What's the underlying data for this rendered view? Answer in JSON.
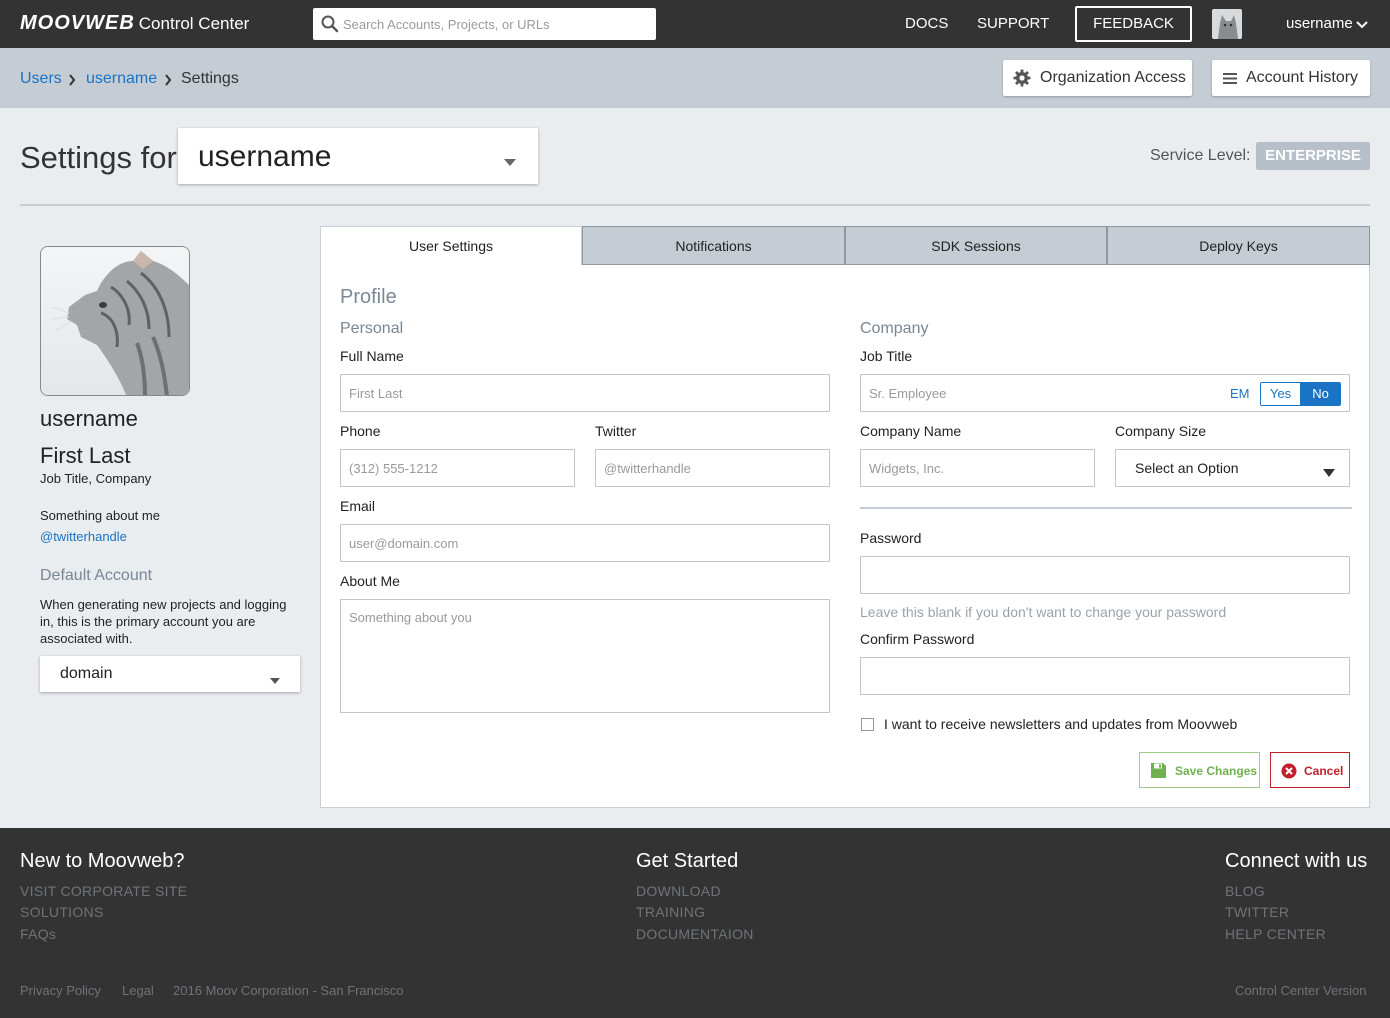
{
  "header": {
    "logo": "MOOVWEB",
    "logo_suffix": "Control Center",
    "search_placeholder": "Search Accounts, Projects, or URLs",
    "links": [
      "DOCS",
      "SUPPORT"
    ],
    "feedback_label": "FEEDBACK",
    "username": "username"
  },
  "breadcrumb": {
    "items": [
      "Users",
      "username",
      "Settings"
    ]
  },
  "header_buttons": {
    "org_access": "Organization Access",
    "account_history": "Account History"
  },
  "page": {
    "settings_for": "Settings for",
    "selected_user": "username",
    "service_level_label": "Service Level:",
    "service_level_value": "ENTERPRISE"
  },
  "profile_card": {
    "username": "username",
    "full_name": "First Last",
    "job_company": "Job Title, Company",
    "about": "Something about me",
    "twitter": "@twitterhandle",
    "default_account_heading": "Default Account",
    "default_account_desc": "When generating new projects and logging in, this is the primary account you are associated with.",
    "default_account_value": "domain"
  },
  "tabs": [
    {
      "label": "User Settings",
      "active": true
    },
    {
      "label": "Notifications",
      "active": false
    },
    {
      "label": "SDK Sessions",
      "active": false
    },
    {
      "label": "Deploy Keys",
      "active": false
    }
  ],
  "form": {
    "profile_heading": "Profile",
    "personal_heading": "Personal",
    "company_heading": "Company",
    "full_name": {
      "label": "Full Name",
      "placeholder": "First Last",
      "value": ""
    },
    "phone": {
      "label": "Phone",
      "placeholder": "(312) 555-1212",
      "value": ""
    },
    "twitter": {
      "label": "Twitter",
      "placeholder": "@twitterhandle",
      "value": ""
    },
    "email": {
      "label": "Email",
      "placeholder": "user@domain.com",
      "value": ""
    },
    "about_me": {
      "label": "About Me",
      "placeholder": "Something about you",
      "value": ""
    },
    "job_title": {
      "label": "Job Title",
      "placeholder": "Sr. Employee",
      "value": "",
      "em_label": "EM",
      "yes_label": "Yes",
      "no_label": "No",
      "selected": "No"
    },
    "company_name": {
      "label": "Company Name",
      "placeholder": "Widgets, Inc.",
      "value": ""
    },
    "company_size": {
      "label": "Company Size",
      "value": "Select an Option"
    },
    "password": {
      "label": "Password",
      "value": ""
    },
    "password_hint": "Leave this blank if you don't want to change your password",
    "confirm_password": {
      "label": "Confirm Password",
      "value": ""
    },
    "newsletter_label": "I want to receive newsletters and updates from Moovweb",
    "newsletter_checked": false,
    "save_label": "Save Changes",
    "cancel_label": "Cancel"
  },
  "footer": {
    "col1": {
      "heading": "New to Moovweb?",
      "links": [
        "VISIT CORPORATE SITE",
        "SOLUTIONS",
        "FAQs"
      ]
    },
    "col2": {
      "heading": "Get Started",
      "links": [
        "DOWNLOAD",
        "TRAINING",
        "DOCUMENTAION"
      ]
    },
    "col3": {
      "heading": "Connect with us",
      "links": [
        "BLOG",
        "TWITTER",
        "HELP CENTER"
      ]
    },
    "bottom": {
      "privacy": "Privacy Policy",
      "legal": "Legal",
      "copyright": "2016 Moov Corporation - San Francisco",
      "version": "Control Center Version"
    }
  },
  "colors": {
    "topbar_bg": "#333334",
    "crumbbar_bg": "#c5ccd4",
    "page_bg": "#eaedf0",
    "link_blue": "#1a73c4",
    "save_green": "#6fb04f",
    "cancel_red": "#c2202b",
    "badge_gray": "#b7c0c9"
  },
  "icons": {
    "search": "search-icon",
    "chevron": "chevron-down-icon",
    "crumb_sep": "chevron-right-icon",
    "org_access": "gear-icon",
    "history": "menu-lines-icon",
    "save": "floppy-disk-icon",
    "cancel": "close-circle-icon",
    "caret": "caret-down-icon"
  }
}
